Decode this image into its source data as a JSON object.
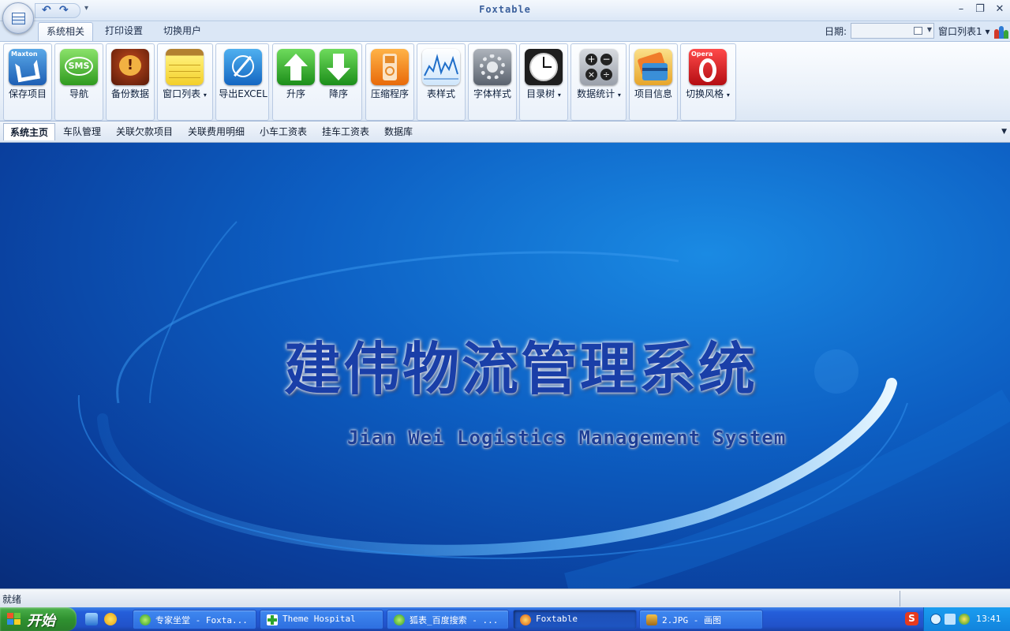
{
  "window": {
    "title": "Foxtable",
    "minimize": "–",
    "maximize": "❐",
    "close": "✕"
  },
  "quick_access": {
    "undo": "↶",
    "redo": "↷",
    "more": "▾"
  },
  "ribbon_tabs": [
    "系统相关",
    "打印设置",
    "切换用户"
  ],
  "header_right": {
    "date_label": "日期:",
    "date_value": "",
    "window_list": "窗口列表1 ▾"
  },
  "ribbon_buttons": {
    "save_project": "保存项目",
    "navigate": "导航",
    "backup": "备份数据",
    "window_list": "窗口列表",
    "export_excel": "导出EXCEL",
    "ascending": "升序",
    "descending": "降序",
    "compress": "压缩程序",
    "table_style": "表样式",
    "font_style": "字体样式",
    "directory_tree": "目录树",
    "statistics": "数据统计",
    "project_info": "项目信息",
    "switch_style": "切换风格"
  },
  "icon_texts": {
    "maxton": "Maxton",
    "sms": "SMS",
    "opera": "Opera"
  },
  "document_tabs": [
    "系统主页",
    "车队管理",
    "关联欠款项目",
    "关联费用明细",
    "小车工资表",
    "挂车工资表",
    "数据库"
  ],
  "splash": {
    "title_cn": "建伟物流管理系统",
    "title_en": "Jian  Wei Logistics Management System"
  },
  "status": {
    "text": "就绪"
  },
  "taskbar": {
    "start_label": "开始",
    "tasks": [
      "专家坐堂 - Foxta...",
      "Theme Hospital",
      "狐表_百度搜索 - ...",
      "Foxtable",
      "2.JPG - 画图"
    ],
    "clock": "13:41"
  },
  "colors": {
    "ribbon_accent": "#2f5fae",
    "splash_blue": "#0d5fc3",
    "taskbar_blue": "#245edb",
    "start_green": "#2f9130"
  }
}
